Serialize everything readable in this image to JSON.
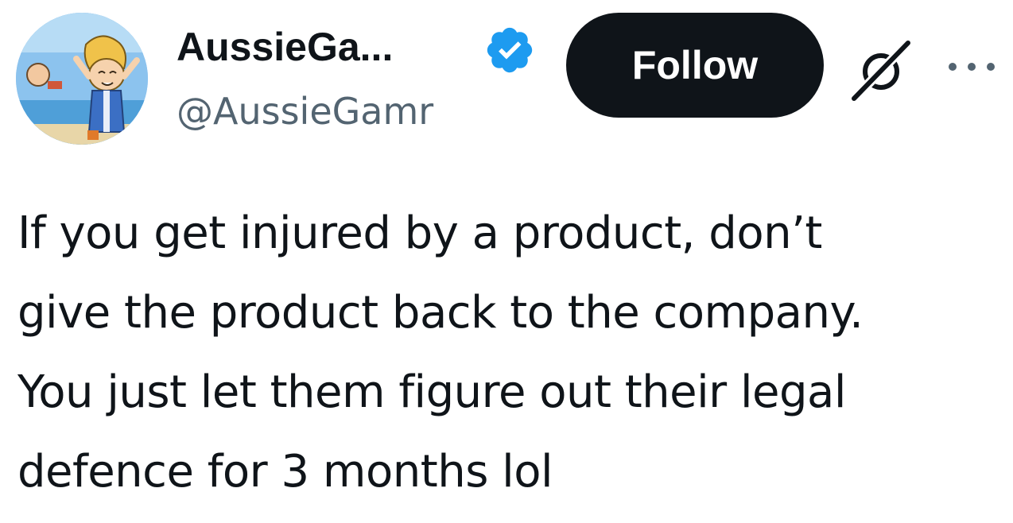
{
  "author": {
    "display_name": "AussieGa...",
    "handle": "@AussieGamr",
    "verified": true,
    "verified_color": "#1d9bf0",
    "avatar_icon": "cartoon-character-avatar"
  },
  "actions": {
    "follow_label": "Follow",
    "grok_icon": "grok-icon",
    "more_icon": "more-options-icon"
  },
  "tweet": {
    "lines": [
      "If you get injured by a product, don’t",
      "give the product back to the company.",
      "You just let them figure out their legal",
      "defence for 3 months lol"
    ]
  },
  "colors": {
    "text": "#0f1419",
    "secondary_text": "#536471",
    "follow_bg": "#0f1419",
    "follow_text": "#ffffff"
  }
}
